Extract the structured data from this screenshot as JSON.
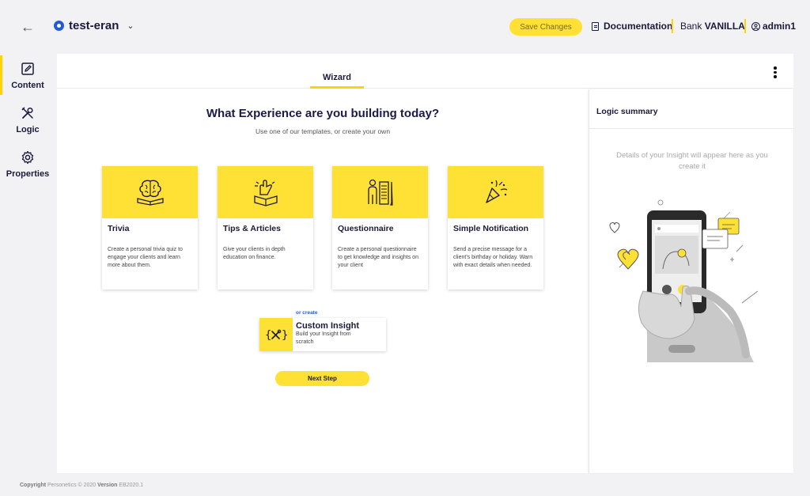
{
  "header": {
    "project_name": "test-eran",
    "save_label": "Save Changes",
    "doc_label": "Documentation",
    "bank_prefix": "Bank",
    "bank_name": "VANILLA",
    "user": "admin1"
  },
  "nav": [
    {
      "label": "Content",
      "icon": "edit-icon"
    },
    {
      "label": "Logic",
      "icon": "tools-icon"
    },
    {
      "label": "Properties",
      "icon": "gear-icon"
    }
  ],
  "tab": {
    "label": "Wizard"
  },
  "wizard": {
    "title": "What Experience are you building today?",
    "subtitle": "Use one of our templates, or create your own",
    "cards": [
      {
        "title": "Trivia",
        "desc": "Create a personal trivia quiz to engage your clients and learn more about them.",
        "icon": "brain-book-icon"
      },
      {
        "title": "Tips & Articles",
        "desc": "Give your clients in depth education on finance.",
        "icon": "hand-book-icon"
      },
      {
        "title": "Questionnaire",
        "desc": "Create a personal questionnaire to get knowledge and insights on your client",
        "icon": "person-checklist-icon"
      },
      {
        "title": "Simple Notification",
        "desc": "Send a precise message for a client's birthday or holiday. Warn with exact details when needed.",
        "icon": "party-popper-icon"
      }
    ],
    "or_create": "or create",
    "custom": {
      "title": "Custom Insight",
      "desc": "Build your Insight from scratch",
      "icon": "tools-icon"
    },
    "next_label": "Next Step"
  },
  "summary": {
    "title": "Logic summary",
    "message": "Details of your Insight will appear here as you create it"
  },
  "footer": {
    "copyright": "Copyright",
    "company": " Personetics © 2020 ",
    "version_label": "Version",
    "version": " EB2020.1"
  },
  "colors": {
    "accent": "#ffe135",
    "brand_blue": "#1f5bd8",
    "text": "#1a1a3a"
  }
}
